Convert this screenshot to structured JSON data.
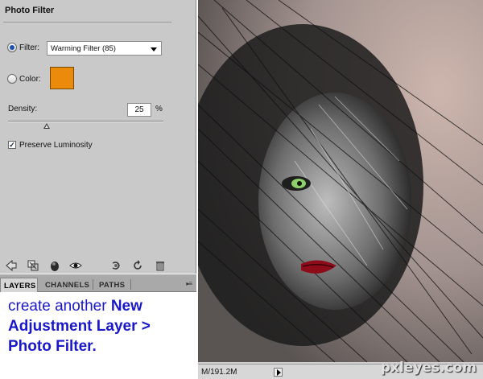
{
  "adjustments_panel": {
    "title": "Photo Filter",
    "filter_label": "Filter:",
    "filter_value": "Warming Filter (85)",
    "color_label": "Color:",
    "color_swatch": "#ec8a0c",
    "density_label": "Density:",
    "density_value": "25",
    "density_unit": "%",
    "density_level_percent": 25,
    "preserve_label": "Preserve Luminosity",
    "preserve_checked": true,
    "filter_radio_selected": true
  },
  "icon_bar": {
    "icons": [
      "back-arrow-icon",
      "panel-view-icon",
      "clip-layer-icon",
      "visibility-eye-icon",
      "previous-state-icon",
      "reset-icon",
      "trash-icon"
    ]
  },
  "tabs": [
    {
      "label": "LAYERS",
      "active": true
    },
    {
      "label": "CHANNELS",
      "active": false
    },
    {
      "label": "PATHS",
      "active": false
    }
  ],
  "panel_menu_icon": "panel-menu-icon",
  "instruction": {
    "part1": "create another ",
    "part2": "New Adjustment Layer > Photo Filter."
  },
  "status_bar": {
    "doc_size": "M/191.2M"
  },
  "watermark": "pxleyes.com"
}
